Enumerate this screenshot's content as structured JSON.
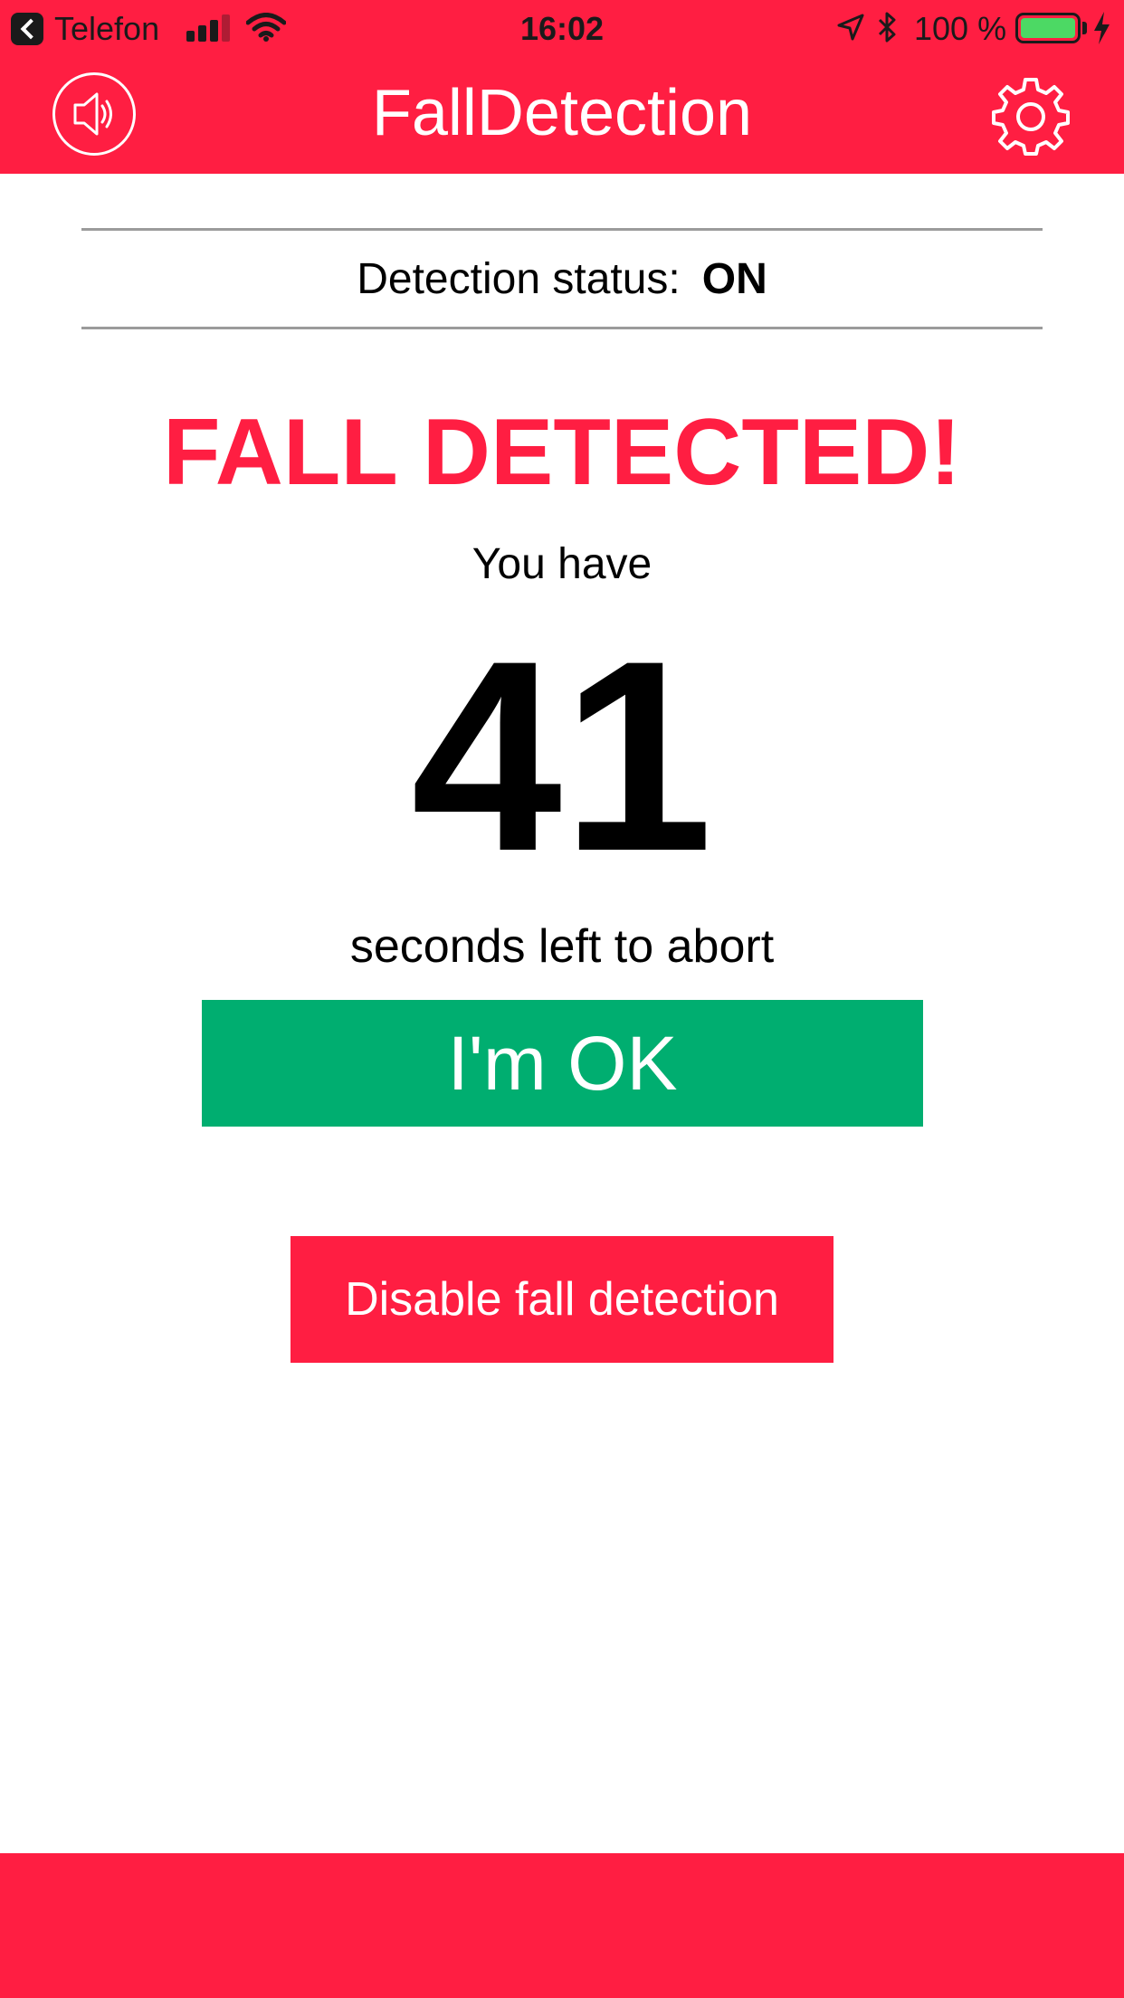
{
  "colors": {
    "brand_red": "#ff1e42",
    "ok_green": "#00ae70",
    "divider_gray": "#9b9b9b",
    "battery_green": "#4cd964"
  },
  "status_bar": {
    "carrier": "Telefon",
    "time": "16:02",
    "battery_percent": "100 %",
    "battery_level": 1.0,
    "icons": [
      "back-app-icon",
      "signal-icon",
      "wifi-icon",
      "location-icon",
      "bluetooth-icon",
      "battery-icon",
      "charging-icon"
    ]
  },
  "nav": {
    "title": "FallDetection",
    "left_icon": "speaker-icon",
    "right_icon": "gear-icon"
  },
  "detection": {
    "label": "Detection status:",
    "value": "ON"
  },
  "alert": {
    "title": "FALL DETECTED!",
    "prefix": "You have",
    "seconds": "41",
    "suffix": "seconds left to abort"
  },
  "buttons": {
    "ok_label": "I'm OK",
    "disable_label": "Disable fall detection"
  }
}
